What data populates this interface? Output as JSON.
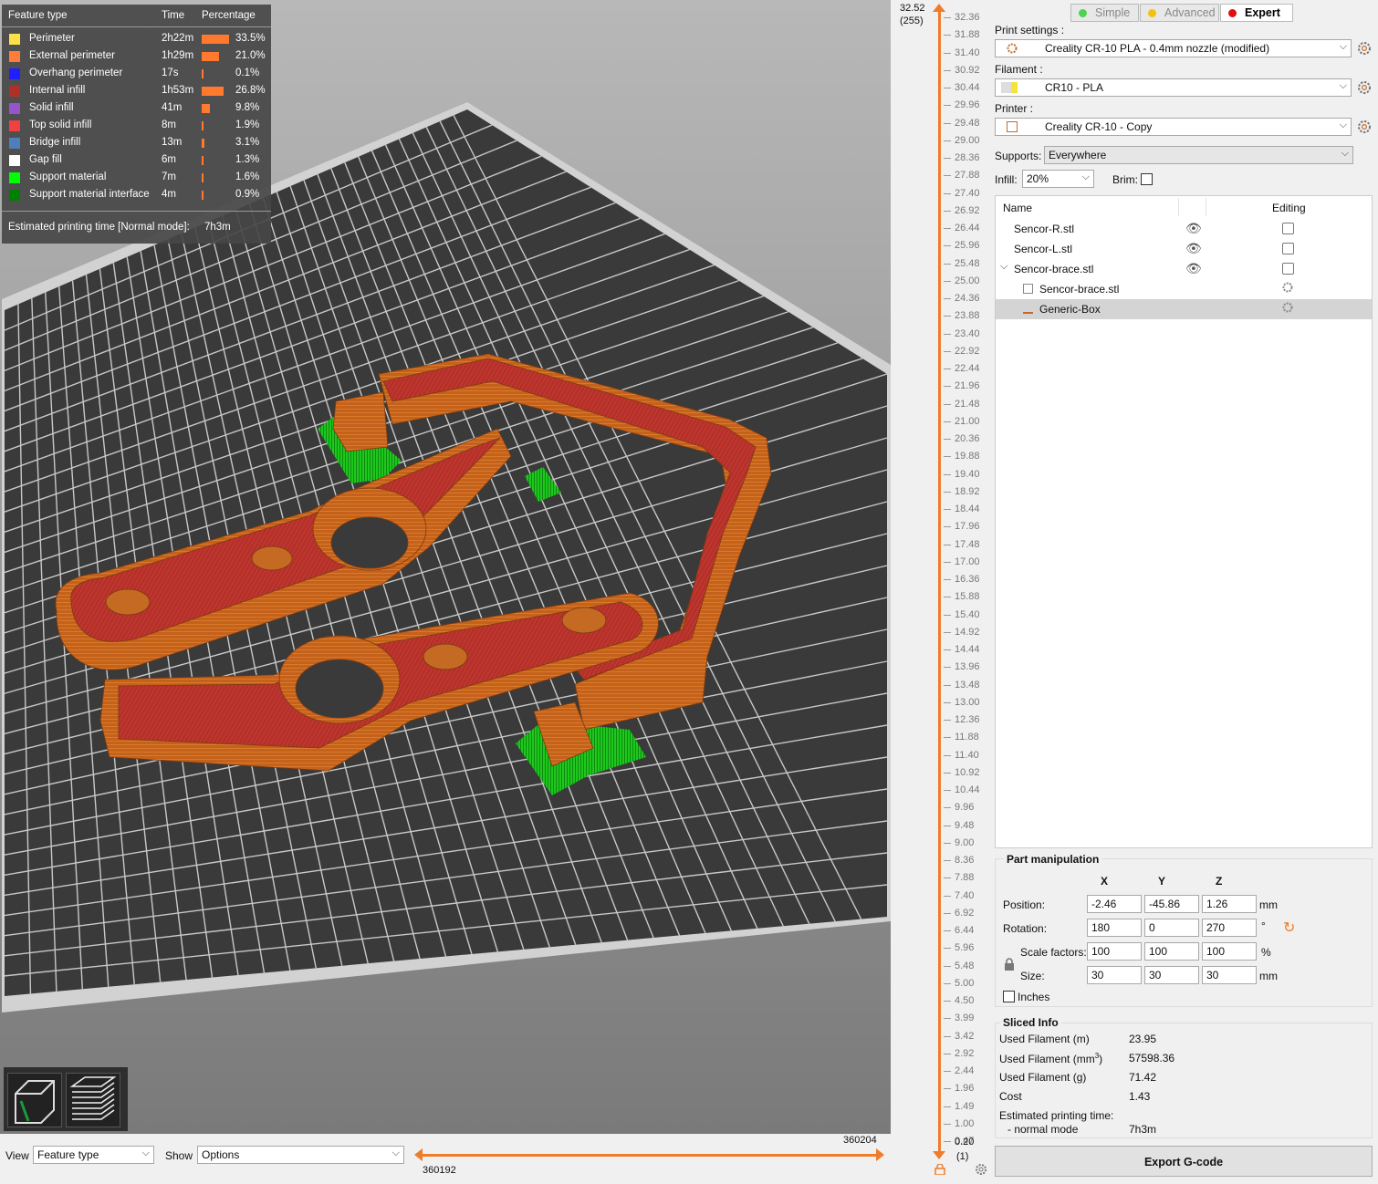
{
  "legend": {
    "headers": {
      "feature": "Feature type",
      "time": "Time",
      "percentage": "Percentage"
    },
    "rows": [
      {
        "name": "Perimeter",
        "time": "2h22m",
        "pct": "33.5%",
        "color": "#ffe04a",
        "share": 0.335
      },
      {
        "name": "External perimeter",
        "time": "1h29m",
        "pct": "21.0%",
        "color": "#ff7d38",
        "share": 0.21
      },
      {
        "name": "Overhang perimeter",
        "time": "17s",
        "pct": "0.1%",
        "color": "#1f1fff",
        "share": 0.001
      },
      {
        "name": "Internal infill",
        "time": "1h53m",
        "pct": "26.8%",
        "color": "#b03029",
        "share": 0.268
      },
      {
        "name": "Solid infill",
        "time": "41m",
        "pct": "9.8%",
        "color": "#9654cc",
        "share": 0.098
      },
      {
        "name": "Top solid infill",
        "time": "8m",
        "pct": "1.9%",
        "color": "#f04040",
        "share": 0.019
      },
      {
        "name": "Bridge infill",
        "time": "13m",
        "pct": "3.1%",
        "color": "#4d80ba",
        "share": 0.031
      },
      {
        "name": "Gap fill",
        "time": "6m",
        "pct": "1.3%",
        "color": "#ffffff",
        "share": 0.013
      },
      {
        "name": "Support material",
        "time": "7m",
        "pct": "1.6%",
        "color": "#00ff00",
        "share": 0.016
      },
      {
        "name": "Support material interface",
        "time": "4m",
        "pct": "0.9%",
        "color": "#008000",
        "share": 0.009
      }
    ],
    "estimated_label": "Estimated printing time [Normal mode]:",
    "estimated_value": "7h3m"
  },
  "bottom": {
    "view_label": "View",
    "view_value": "Feature type",
    "show_label": "Show",
    "show_value": "Options",
    "hslider_top": "360204",
    "hslider_bottom": "360192"
  },
  "vslider": {
    "top_value": "32.52",
    "top_layer": "(255)",
    "bottom_value": "0.20",
    "bottom_layer": "(1)",
    "ticks": [
      "32.36",
      "31.88",
      "31.40",
      "30.92",
      "30.44",
      "29.96",
      "29.48",
      "29.00",
      "28.36",
      "27.88",
      "27.40",
      "26.92",
      "26.44",
      "25.96",
      "25.48",
      "25.00",
      "24.36",
      "23.88",
      "23.40",
      "22.92",
      "22.44",
      "21.96",
      "21.48",
      "21.00",
      "20.36",
      "19.88",
      "19.40",
      "18.92",
      "18.44",
      "17.96",
      "17.48",
      "17.00",
      "16.36",
      "15.88",
      "15.40",
      "14.92",
      "14.44",
      "13.96",
      "13.48",
      "13.00",
      "12.36",
      "11.88",
      "11.40",
      "10.92",
      "10.44",
      "9.96",
      "9.48",
      "9.00",
      "8.36",
      "7.88",
      "7.40",
      "6.92",
      "6.44",
      "5.96",
      "5.48",
      "5.00",
      "4.50",
      "3.99",
      "3.42",
      "2.92",
      "2.44",
      "1.96",
      "1.49",
      "1.00",
      "0.47"
    ]
  },
  "panel": {
    "modes": {
      "simple": "Simple",
      "advanced": "Advanced",
      "expert": "Expert"
    },
    "print_settings_label": "Print settings :",
    "print_settings_value": "Creality CR-10 PLA  - 0.4mm nozzle (modified)",
    "filament_label": "Filament :",
    "filament_value": "CR10 - PLA",
    "printer_label": "Printer :",
    "printer_value": "Creality CR-10 - Copy",
    "supports_label": "Supports:",
    "supports_value": "Everywhere",
    "infill_label": "Infill:",
    "infill_value": "20%",
    "brim_label": "Brim:",
    "objects": {
      "col_name": "Name",
      "col_editing": "Editing",
      "items": [
        "Sencor-R.stl",
        "Sencor-L.stl",
        "Sencor-brace.stl",
        "Sencor-brace.stl",
        "Generic-Box"
      ]
    },
    "part": {
      "title": "Part manipulation",
      "x": "X",
      "y": "Y",
      "z": "Z",
      "position_label": "Position:",
      "position": [
        "-2.46",
        "-45.86",
        "1.26"
      ],
      "position_unit": "mm",
      "rotation_label": "Rotation:",
      "rotation": [
        "180",
        "0",
        "270"
      ],
      "rotation_unit": "°",
      "scale_label": "Scale factors:",
      "scale": [
        "100",
        "100",
        "100"
      ],
      "scale_unit": "%",
      "size_label": "Size:",
      "size": [
        "30",
        "30",
        "30"
      ],
      "size_unit": "mm",
      "inches_label": "Inches"
    },
    "sliced": {
      "title": "Sliced Info",
      "used_m_label": "Used Filament (m)",
      "used_m": "23.95",
      "used_mm3_label": "Used Filament (mm",
      "used_mm3_sup": "3",
      "used_mm3_close": ")",
      "used_mm3": "57598.36",
      "used_g_label": "Used Filament (g)",
      "used_g": "71.42",
      "cost_label": "Cost",
      "cost": "1.43",
      "est_label": "Estimated printing time:",
      "normal_label": "- normal mode",
      "normal_value": "7h3m"
    },
    "export_label": "Export G-code"
  },
  "colors": {
    "bed": "#3c3c3c",
    "grid": "#c8c8c8",
    "part_orange": "#c9651c",
    "part_infill": "#b7302c",
    "support_green": "#1fd21f",
    "accent": "#ef7c2a"
  }
}
